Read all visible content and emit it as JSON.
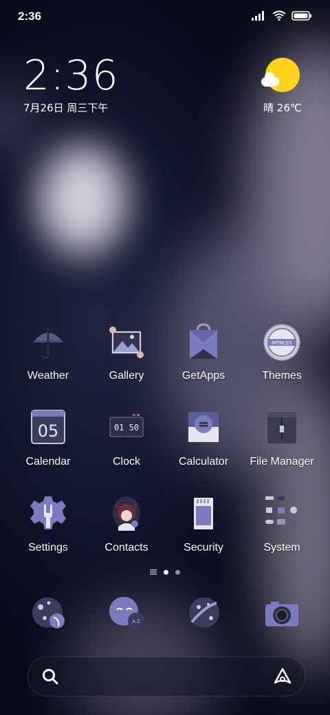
{
  "status_bar": {
    "time": "2:36"
  },
  "clock_widget": {
    "time": "2:36",
    "date": "7月26日 周三下午"
  },
  "weather_widget": {
    "text": "晴 26℃"
  },
  "apps": [
    {
      "label": "Weather"
    },
    {
      "label": "Gallery"
    },
    {
      "label": "GetApps"
    },
    {
      "label": "Themes"
    },
    {
      "label": "Calendar"
    },
    {
      "label": "Clock"
    },
    {
      "label": "Calculator"
    },
    {
      "label": "File Manager"
    },
    {
      "label": "Settings"
    },
    {
      "label": "Contacts"
    },
    {
      "label": "Security"
    },
    {
      "label": "System"
    }
  ],
  "icon_text": {
    "calendar_day": "05",
    "clock_display": "01 50",
    "themes_badge": "MTNLSS"
  },
  "pagination": {
    "current_page": 1,
    "page_count": 2
  },
  "dock": [
    {
      "icon": "app-icon-planet"
    },
    {
      "icon": "messaging-icon"
    },
    {
      "icon": "browser-icon"
    },
    {
      "icon": "camera-icon"
    }
  ],
  "colors": {
    "accent": "#7b7bbd",
    "sun": "#ffd21e"
  }
}
